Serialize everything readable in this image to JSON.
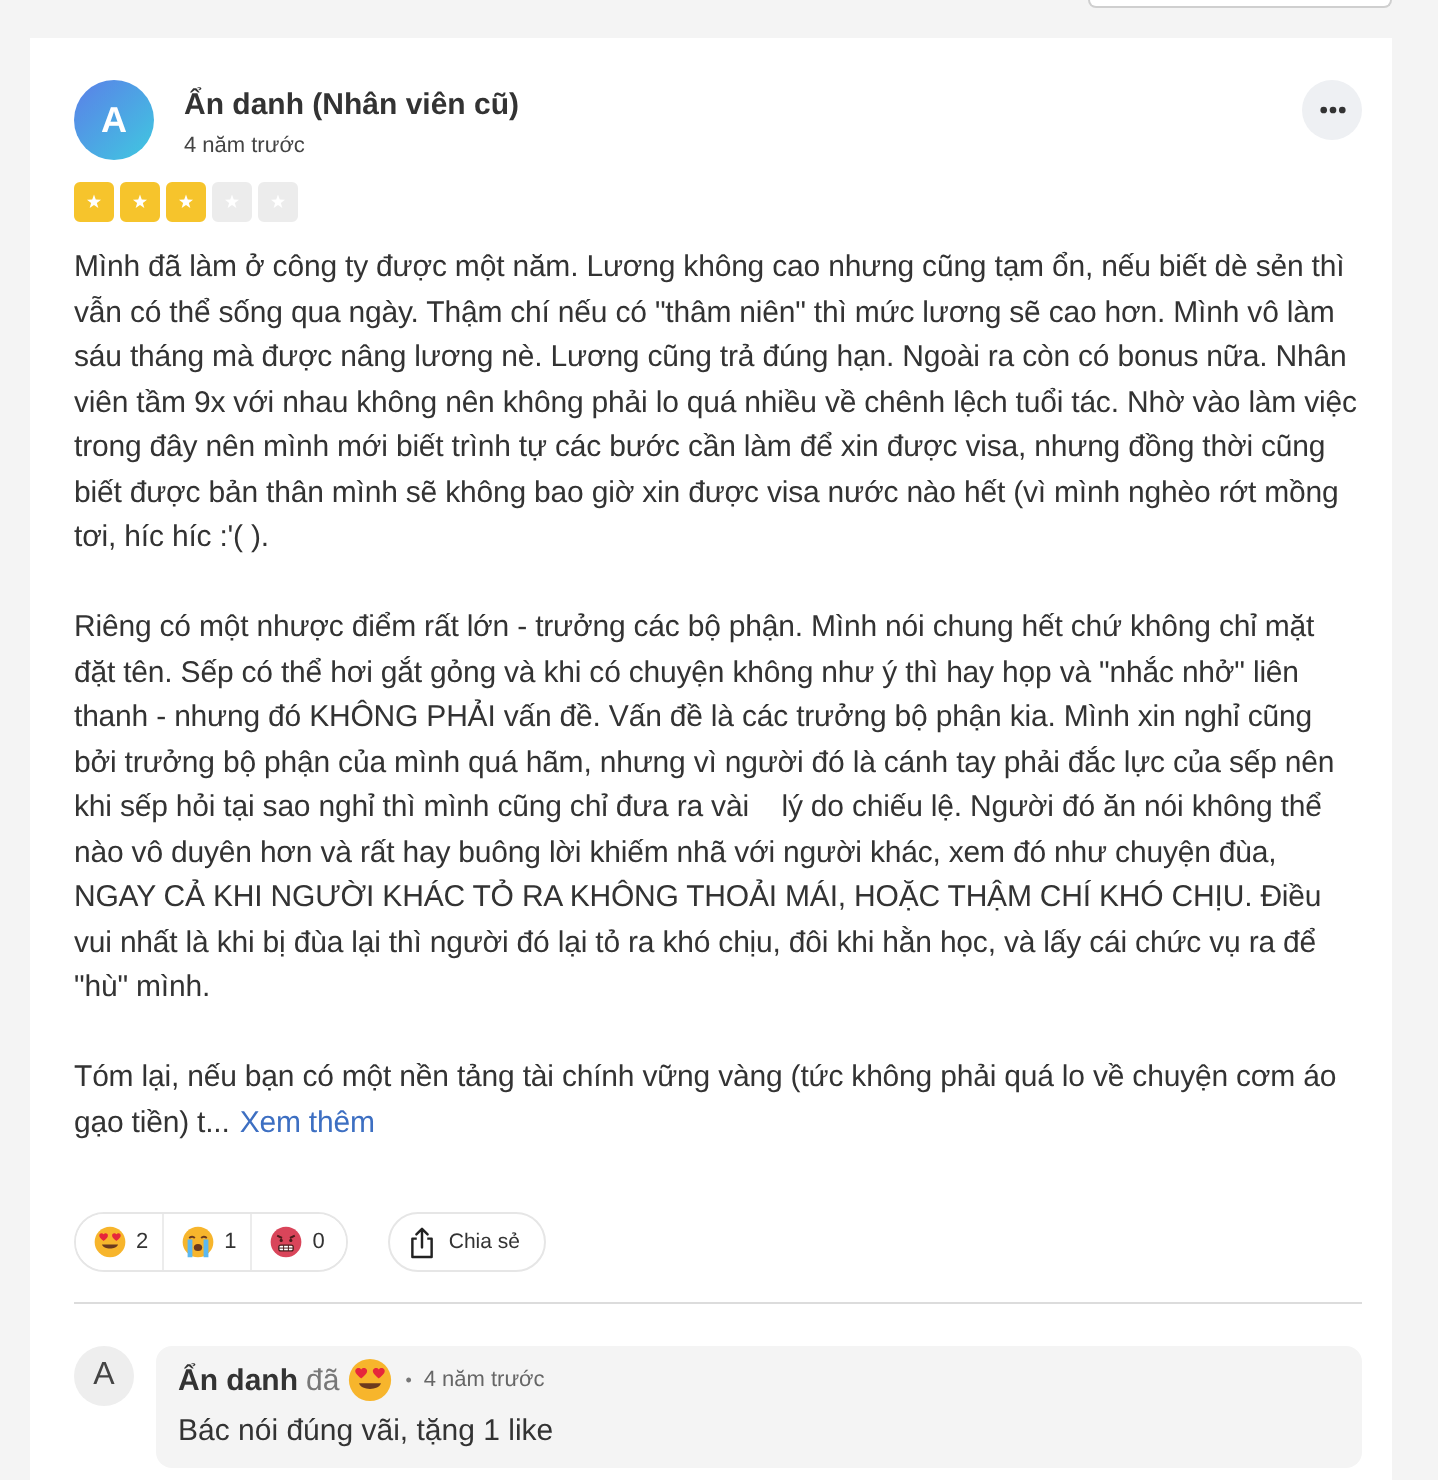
{
  "review": {
    "avatar_letter": "A",
    "author": "Ẩn danh (Nhân viên cũ)",
    "time": "4 năm trước",
    "stars": 3,
    "paragraphs": [
      "Mình đã làm ở công ty được một năm. Lương không cao nhưng cũng tạm ổn, nếu biết dè sẻn thì vẫn có thể sống qua ngày. Thậm chí nếu có \"thâm niên\" thì mức lương sẽ cao hơn. Mình vô làm sáu tháng mà được nâng lương nè. Lương cũng trả đúng hạn. Ngoài ra còn có bonus nữa. Nhân viên tầm 9x với nhau không nên không phải lo quá nhiều về chênh lệch tuổi tác. Nhờ vào làm việc trong đây nên mình mới biết trình tự các bước cần làm để xin được visa, nhưng đồng thời cũng biết được bản thân mình sẽ không bao giờ xin được visa nước nào hết (vì mình nghèo rớt mồng tơi, híc híc :'( ).",
      "Riêng có một nhược điểm rất lớn - trưởng các bộ phận. Mình nói chung hết chứ không chỉ mặt đặt tên. Sếp có thể hơi gắt gỏng và khi có chuyện không như ý thì hay họp và \"nhắc nhở\" liên thanh - nhưng đó KHÔNG PHẢI vấn đề. Vấn đề là các trưởng bộ phận kia. Mình xin nghỉ cũng bởi trưởng bộ phận của mình quá hãm, nhưng vì người đó là cánh tay phải đắc lực của sếp nên khi sếp hỏi tại sao nghỉ thì mình cũng chỉ đưa ra vài    lý do chiếu lệ. Người đó ăn nói không thể nào vô duyên hơn và rất hay buông lời khiếm nhã với người khác, xem đó như chuyện đùa, NGAY CẢ KHI NGƯỜI KHÁC TỎ RA KHÔNG THOẢI MÁI, HOẶC THẬM CHÍ KHÓ CHỊU. Điều vui nhất là khi bị đùa lại thì người đó lại tỏ ra khó chịu, đôi khi hằn học, và lấy cái chức vụ ra để \"hù\" mình.",
      "Tóm lại, nếu bạn có một nền tảng tài chính vững vàng (tức không phải quá lo về chuyện cơm áo gạo tiền) t..."
    ],
    "more_link": "Xem thêm"
  },
  "reactions": [
    {
      "kind": "love",
      "count": "2"
    },
    {
      "kind": "cry",
      "count": "1"
    },
    {
      "kind": "angry",
      "count": "0"
    }
  ],
  "share_button": "Chia sẻ",
  "comments": [
    {
      "avatar_letter": "A",
      "author": "Ẩn danh",
      "action": "đã",
      "reaction": {
        "kind": "love"
      },
      "separator": "•",
      "time": "4 năm trước",
      "text": "Bác nói đúng vãi, tặng 1 like"
    }
  ]
}
